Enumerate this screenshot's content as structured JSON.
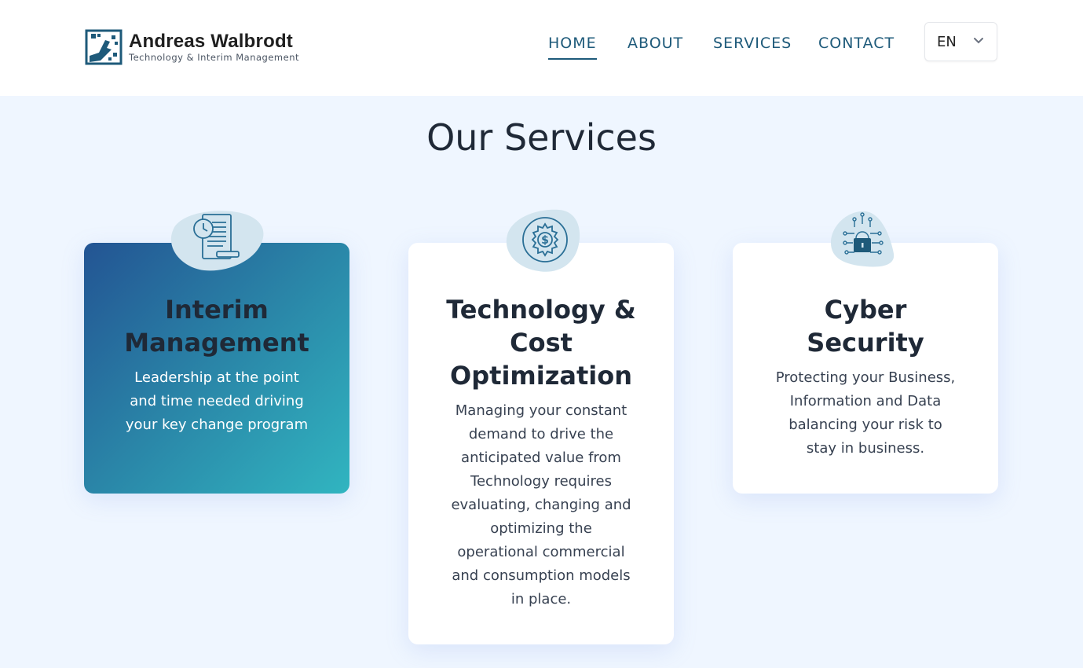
{
  "brand": {
    "name": "Andreas Walbrodt",
    "tagline": "Technology & Interim Management"
  },
  "nav": {
    "items": [
      {
        "label": "HOME",
        "active": true
      },
      {
        "label": "ABOUT",
        "active": false
      },
      {
        "label": "SERVICES",
        "active": false
      },
      {
        "label": "CONTACT",
        "active": false
      }
    ],
    "language": {
      "selected": "EN"
    }
  },
  "services": {
    "title": "Our Services",
    "cards": [
      {
        "title": "Interim Management",
        "description": "Leadership at the point and time needed driving your key change program",
        "icon": "document-clock-icon",
        "featured": true
      },
      {
        "title": "Technology & Cost Optimization",
        "description": "Managing your constant demand to drive the anticipated value from Technology requires evaluating, changing and optimizing the operational commercial and consumption models in place.",
        "icon": "gear-dollar-icon",
        "featured": false
      },
      {
        "title": "Cyber Security",
        "description": "Protecting your Business, Information and Data balancing your risk to stay in business.",
        "icon": "circuit-lock-icon",
        "featured": false
      }
    ]
  },
  "colors": {
    "primary": "#1e5a7a",
    "background": "#eff6ff",
    "gradient_start": "#235493",
    "gradient_end": "#31b5c0",
    "icon_blob": "#d3e5ef"
  }
}
